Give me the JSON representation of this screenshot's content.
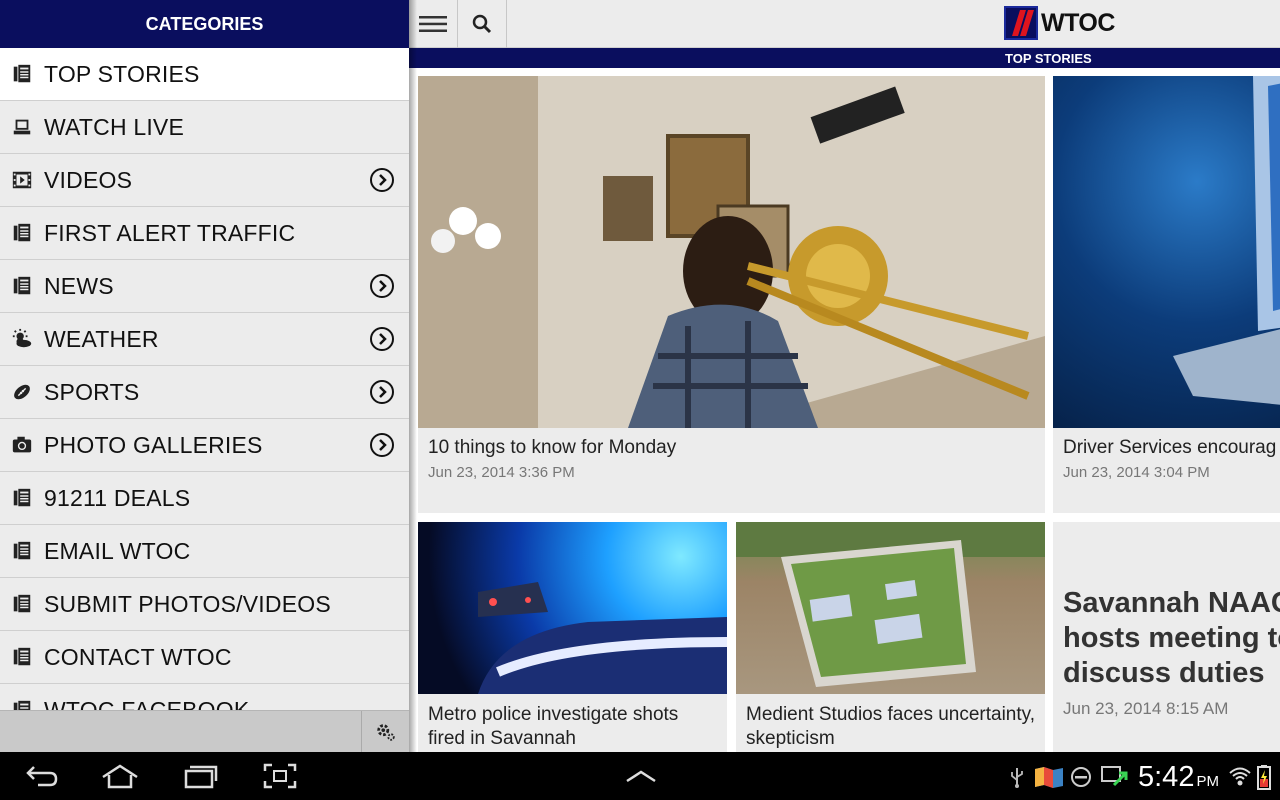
{
  "sidebar": {
    "header": "CATEGORIES",
    "items": [
      {
        "label": "TOP STORIES",
        "icon": "document-icon",
        "chevron": false,
        "active": true
      },
      {
        "label": "WATCH LIVE",
        "icon": "laptop-icon",
        "chevron": false
      },
      {
        "label": "VIDEOS",
        "icon": "film-icon",
        "chevron": true
      },
      {
        "label": "FIRST ALERT TRAFFIC",
        "icon": "document-icon",
        "chevron": false
      },
      {
        "label": "NEWS",
        "icon": "document-icon",
        "chevron": true
      },
      {
        "label": "WEATHER",
        "icon": "sun-cloud-icon",
        "chevron": true
      },
      {
        "label": "SPORTS",
        "icon": "football-icon",
        "chevron": true
      },
      {
        "label": "PHOTO GALLERIES",
        "icon": "camera-icon",
        "chevron": true
      },
      {
        "label": "91211 DEALS",
        "icon": "document-icon",
        "chevron": false
      },
      {
        "label": "EMAIL WTOC",
        "icon": "document-icon",
        "chevron": false
      },
      {
        "label": "SUBMIT PHOTOS/VIDEOS",
        "icon": "document-icon",
        "chevron": false
      },
      {
        "label": "CONTACT WTOC",
        "icon": "document-icon",
        "chevron": false
      },
      {
        "label": "WTOC FACEBOOK",
        "icon": "document-icon",
        "chevron": false
      }
    ]
  },
  "toolbar": {
    "logo_text": "WTOC",
    "section_title": "TOP STORIES"
  },
  "stories": [
    {
      "title": "10 things to know for Monday",
      "date": "Jun 23, 2014 3:36 PM"
    },
    {
      "title": "Driver Services encourag",
      "date": "Jun 23, 2014 3:04 PM"
    },
    {
      "title": "Metro police investigate shots fired in Savannah",
      "date": ""
    },
    {
      "title": "Medient Studios faces uncertainty, skepticism",
      "date": ""
    },
    {
      "title_lines": [
        "Savannah NAAC",
        "hosts meeting to",
        "discuss duties"
      ],
      "date": "Jun 23, 2014 8:15 AM"
    }
  ],
  "status_bar": {
    "time": "5:42",
    "ampm": "PM"
  },
  "colors": {
    "brand_navy": "#0a0e5e",
    "sidebar_bg": "#ececec",
    "card_bg": "#ececec"
  }
}
